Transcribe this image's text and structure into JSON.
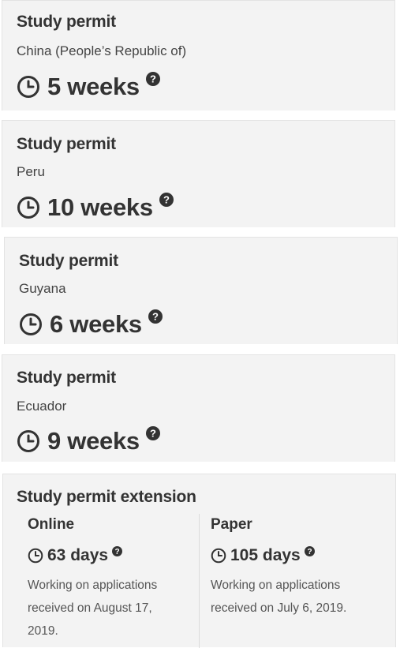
{
  "cards": [
    {
      "title": "Study permit",
      "country": "China (People’s Republic of)",
      "time": "5 weeks"
    },
    {
      "title": "Study permit",
      "country": "Peru",
      "time": "10 weeks"
    },
    {
      "title": "Study permit",
      "country": "Guyana",
      "time": "6 weeks"
    },
    {
      "title": "Study permit",
      "country": "Ecuador",
      "time": "9 weeks"
    }
  ],
  "extension": {
    "title": "Study permit extension",
    "online": {
      "label": "Online",
      "time": "63 days",
      "note_line1": "Working on applications",
      "note_line2": "received on August 17,",
      "note_line3": "2019."
    },
    "paper": {
      "label": "Paper",
      "time": "105 days",
      "note_line1": "Working on applications",
      "note_line2": "received on July 6, 2019."
    }
  },
  "icons": {
    "clock": "clock-icon",
    "help": "help-icon"
  },
  "colors": {
    "card_bg": "#f3f3f3",
    "text": "#333333",
    "icon": "#333333"
  }
}
